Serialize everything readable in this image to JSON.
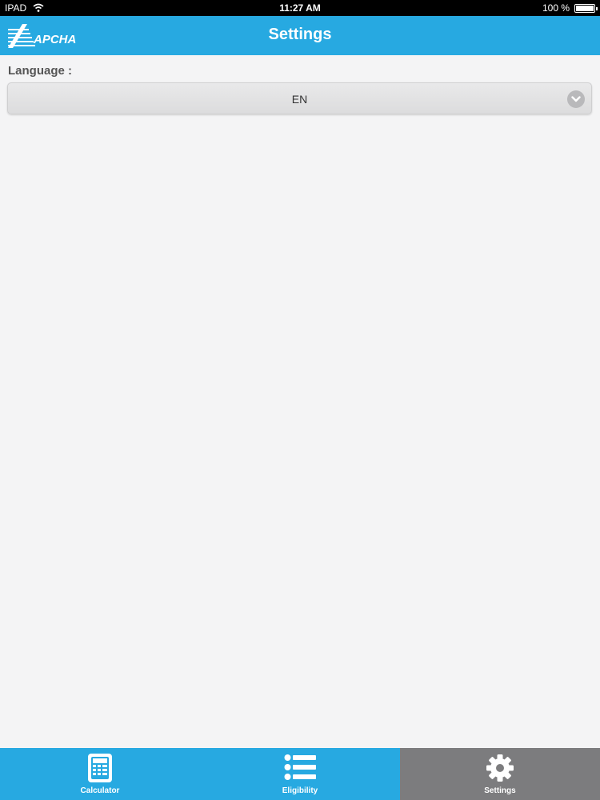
{
  "status_bar": {
    "device": "IPAD",
    "time": "11:27 AM",
    "battery": "100 %",
    "battery_level": 1.0
  },
  "header": {
    "title": "Settings",
    "logo_text": "APCHA"
  },
  "settings": {
    "language_label": "Language :",
    "language_value": "EN"
  },
  "tabbar": {
    "tabs": [
      {
        "label": "Calculator",
        "icon": "calculator-icon",
        "active": false
      },
      {
        "label": "Eligibility",
        "icon": "list-icon",
        "active": false
      },
      {
        "label": "Settings",
        "icon": "gear-icon",
        "active": true
      }
    ]
  },
  "colors": {
    "accent": "#27a9e1",
    "active_tab": "#7c7c7e",
    "background": "#f4f4f5"
  }
}
